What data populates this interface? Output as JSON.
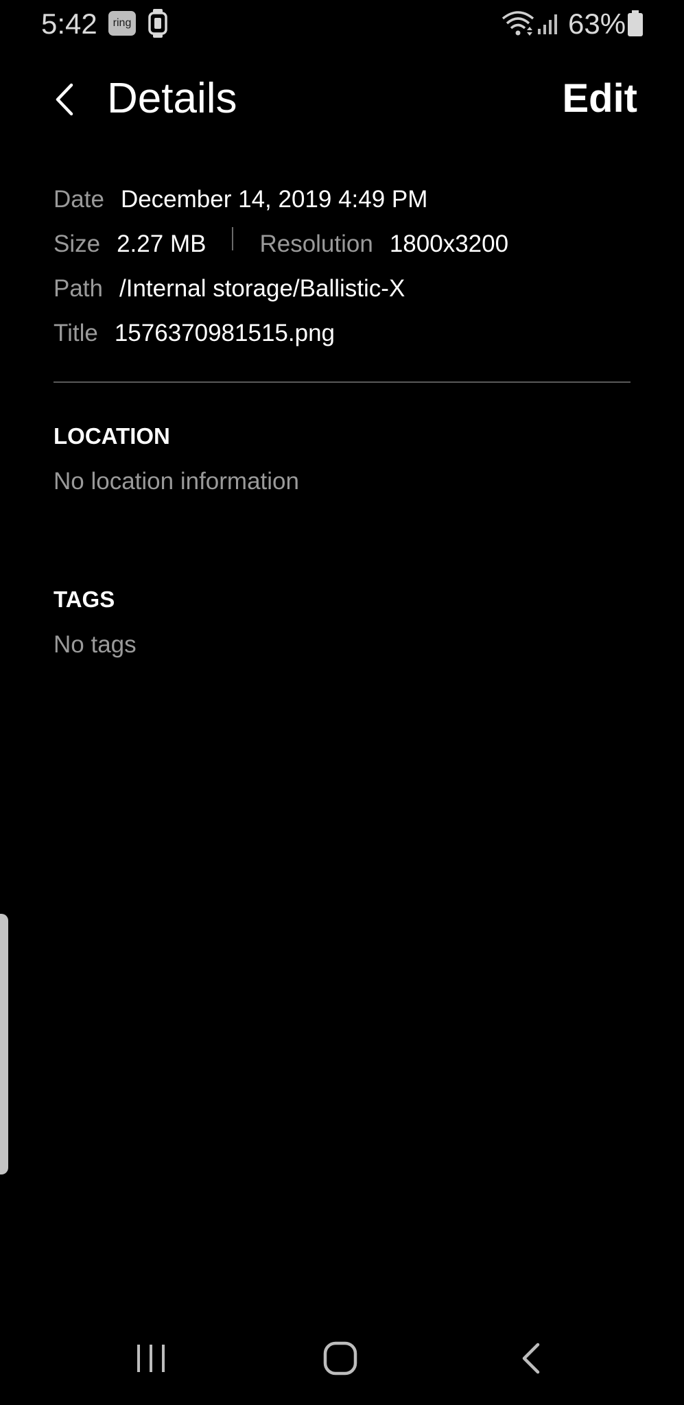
{
  "status_bar": {
    "time": "5:42",
    "ring_label": "ring",
    "battery_percent": "63%",
    "icons": [
      "ring-app-icon",
      "smartwatch-icon",
      "wifi-icon",
      "signal-icon",
      "battery-icon"
    ]
  },
  "header": {
    "title": "Details",
    "edit_label": "Edit",
    "back_icon": "chevron-left-icon"
  },
  "details": {
    "date_label": "Date",
    "date_value": "December 14, 2019 4:49 PM",
    "size_label": "Size",
    "size_value": "2.27 MB",
    "resolution_label": "Resolution",
    "resolution_value": "1800x3200",
    "path_label": "Path",
    "path_value": "/Internal storage/Ballistic-X",
    "title_label": "Title",
    "title_value": "1576370981515.png"
  },
  "location": {
    "heading": "LOCATION",
    "body": "No location information"
  },
  "tags": {
    "heading": "TAGS",
    "body": "No tags"
  },
  "nav_bar": {
    "icons": [
      "recents-icon",
      "home-icon",
      "back-icon"
    ]
  },
  "colors": {
    "background": "#000000",
    "primary_text": "#ffffff",
    "secondary_text": "#9a9a9a",
    "divider": "#5a5a5a"
  }
}
